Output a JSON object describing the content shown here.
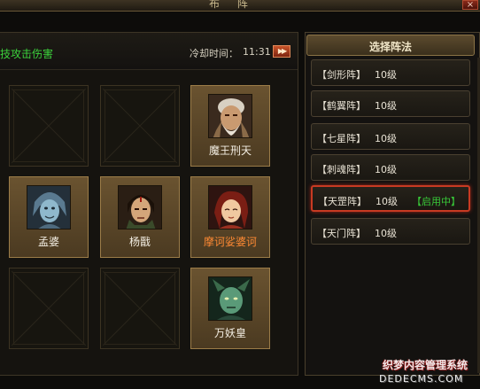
{
  "window": {
    "title": "布 阵",
    "close_label": "×"
  },
  "header": {
    "skill_text": "技攻击伤害",
    "cooldown_label": "冷却时间：",
    "cooldown_value": "11:31",
    "ff_label": "▶▶"
  },
  "grid": {
    "slots": [
      {
        "filled": false
      },
      {
        "filled": false
      },
      {
        "filled": true,
        "name": "魔王刑天",
        "name_color": "white",
        "portrait": "xingtian-portrait"
      },
      {
        "filled": true,
        "name": "孟婆",
        "name_color": "white",
        "portrait": "mengpo-portrait"
      },
      {
        "filled": true,
        "name": "杨戬",
        "name_color": "white",
        "portrait": "yangjian-portrait"
      },
      {
        "filled": true,
        "name": "摩诃娑婆诃",
        "name_color": "orange",
        "portrait": "mohe-portrait"
      },
      {
        "filled": false
      },
      {
        "filled": false
      },
      {
        "filled": true,
        "name": "万妖皇",
        "name_color": "white",
        "portrait": "wanyaohuang-portrait"
      }
    ]
  },
  "formations": {
    "title": "选择阵法",
    "items": [
      {
        "name": "【剑形阵】",
        "level": "10级",
        "status": ""
      },
      {
        "name": "【鹤翼阵】",
        "level": "10级",
        "status": ""
      },
      {
        "name": "【七星阵】",
        "level": "10级",
        "status": ""
      },
      {
        "name": "【刺魂阵】",
        "level": "10级",
        "status": ""
      },
      {
        "name": "【天罡阵】",
        "level": "10级",
        "status": "【启用中】",
        "active": true
      },
      {
        "name": "【天门阵】",
        "level": "10级",
        "status": ""
      }
    ]
  },
  "watermark": {
    "line1": "织梦内容管理系统",
    "line2": "DEDECMS.COM"
  },
  "colors": {
    "green_text": "#3cd23c",
    "orange_name": "#ff8a34",
    "active_border": "#c83a22",
    "gold_frame": "#9b7c48"
  }
}
